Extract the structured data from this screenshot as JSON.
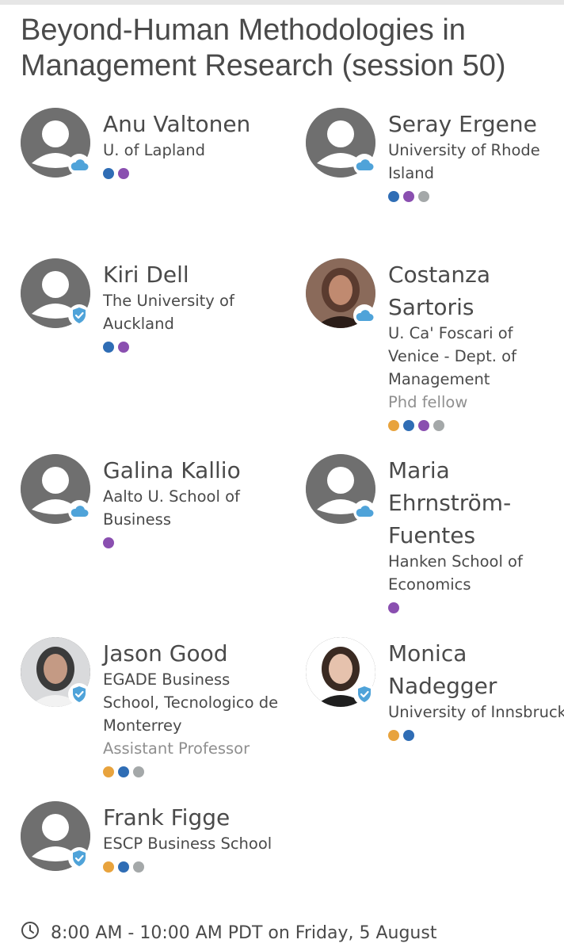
{
  "session_title": "Beyond-Human Methodologies in Management Research (session 50)",
  "colors": {
    "orange": "#e8a33d",
    "blue": "#2f6db5",
    "purple": "#8a4fb0",
    "gray": "#a4a8a9",
    "badge_blue": "#4fa3d9",
    "avatar_gray": "#6f6f6f"
  },
  "people": [
    {
      "name": "Anu Valtonen",
      "org": "U. of Lapland",
      "role": "",
      "badge": "cloud-icon",
      "avatar": "placeholder",
      "dots": [
        "blue",
        "purple"
      ]
    },
    {
      "name": "Seray Ergene",
      "org": "University of Rhode Island",
      "role": "",
      "badge": "cloud-icon",
      "avatar": "placeholder",
      "dots": [
        "blue",
        "purple",
        "gray"
      ]
    },
    {
      "name": "Kiri Dell",
      "org": "The University of Auckland",
      "role": "",
      "badge": "verified-check-icon",
      "avatar": "placeholder",
      "dots": [
        "blue",
        "purple"
      ]
    },
    {
      "name": "Costanza Sartoris",
      "org": "U. Ca' Foscari of Venice - Dept. of Management",
      "role": "Phd fellow",
      "badge": "cloud-icon",
      "avatar": "photo",
      "dots": [
        "orange",
        "blue",
        "purple",
        "gray"
      ]
    },
    {
      "name": "Galina Kallio",
      "org": "Aalto U. School of Business",
      "role": "",
      "badge": "cloud-icon",
      "avatar": "placeholder",
      "dots": [
        "purple"
      ]
    },
    {
      "name": "Maria Ehrnström-Fuentes",
      "org": "Hanken School of Economics",
      "role": "",
      "badge": "cloud-icon",
      "avatar": "placeholder",
      "dots": [
        "purple"
      ]
    },
    {
      "name": "Jason Good",
      "org": "EGADE Business School, Tecnologico de Monterrey",
      "role": "Assistant Professor",
      "badge": "verified-check-icon",
      "avatar": "photo",
      "dots": [
        "orange",
        "blue",
        "gray"
      ]
    },
    {
      "name": "Monica Nadegger",
      "org": "University of Innsbruck",
      "role": "",
      "badge": "verified-check-icon",
      "avatar": "photo",
      "dots": [
        "orange",
        "blue"
      ]
    },
    {
      "name": "Frank Figge",
      "org": "ESCP Business School",
      "role": "",
      "badge": "verified-check-icon",
      "avatar": "placeholder",
      "dots": [
        "orange",
        "blue",
        "gray"
      ]
    }
  ],
  "schedule": {
    "icon": "clock-icon",
    "text": "8:00 AM - 10:00 AM PDT on Friday, 5 August"
  }
}
